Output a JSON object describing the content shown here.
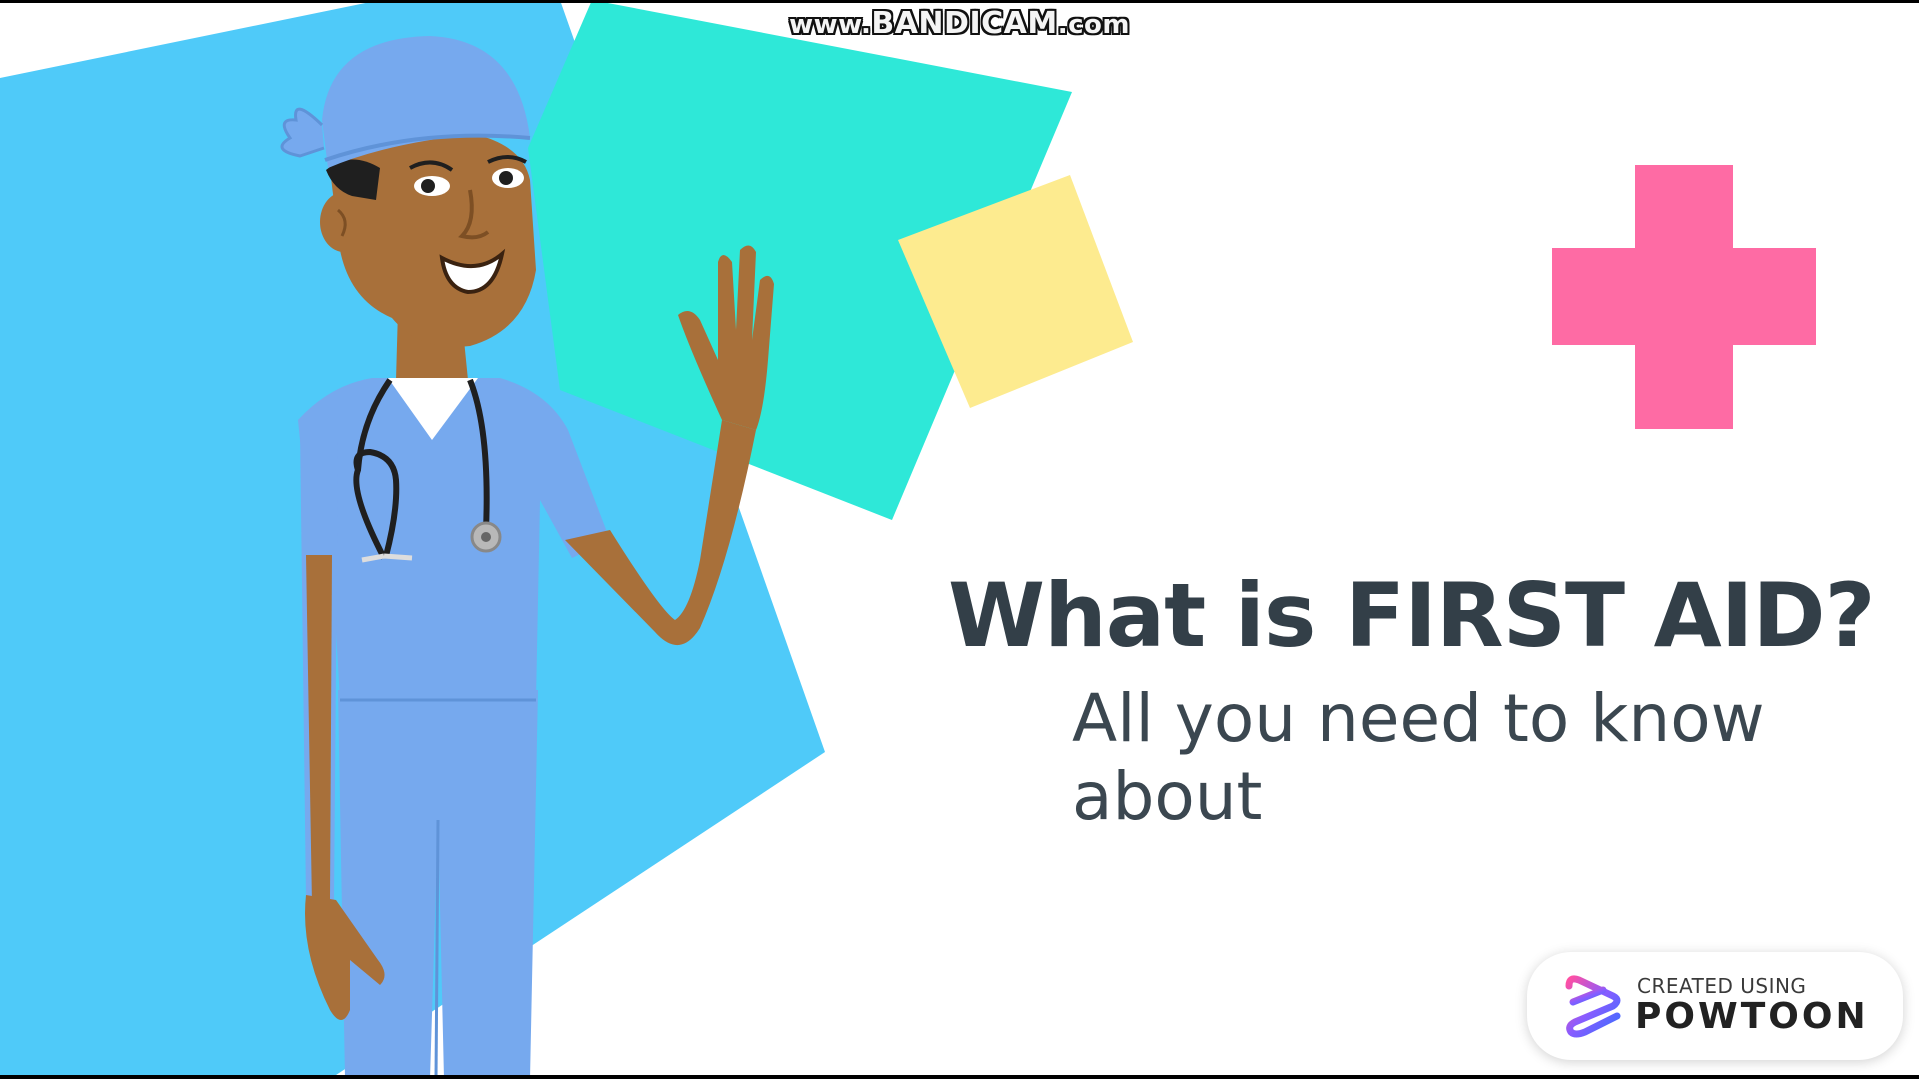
{
  "watermark": {
    "prefix": "www.",
    "brand": "BANDICAM",
    "suffix": ".com"
  },
  "slide": {
    "title": "What is FIRST AID?",
    "subtitle": "All you need to know about"
  },
  "badge": {
    "caption": "CREATED USING",
    "brand": "POWTOON",
    "logo_icon": "powtoon-logo-icon"
  },
  "colors": {
    "blue_shape": "#4fcaf9",
    "teal_shape": "#2ee8d8",
    "yellow_shape": "#fdeb8f",
    "pink_cross": "#fe6ba4",
    "scrubs": "#76a9ee",
    "skin": "#a8703a",
    "title_text": "#333f48"
  },
  "icons": [
    "medical-cross-icon",
    "stethoscope-icon",
    "powtoon-logo-icon"
  ]
}
